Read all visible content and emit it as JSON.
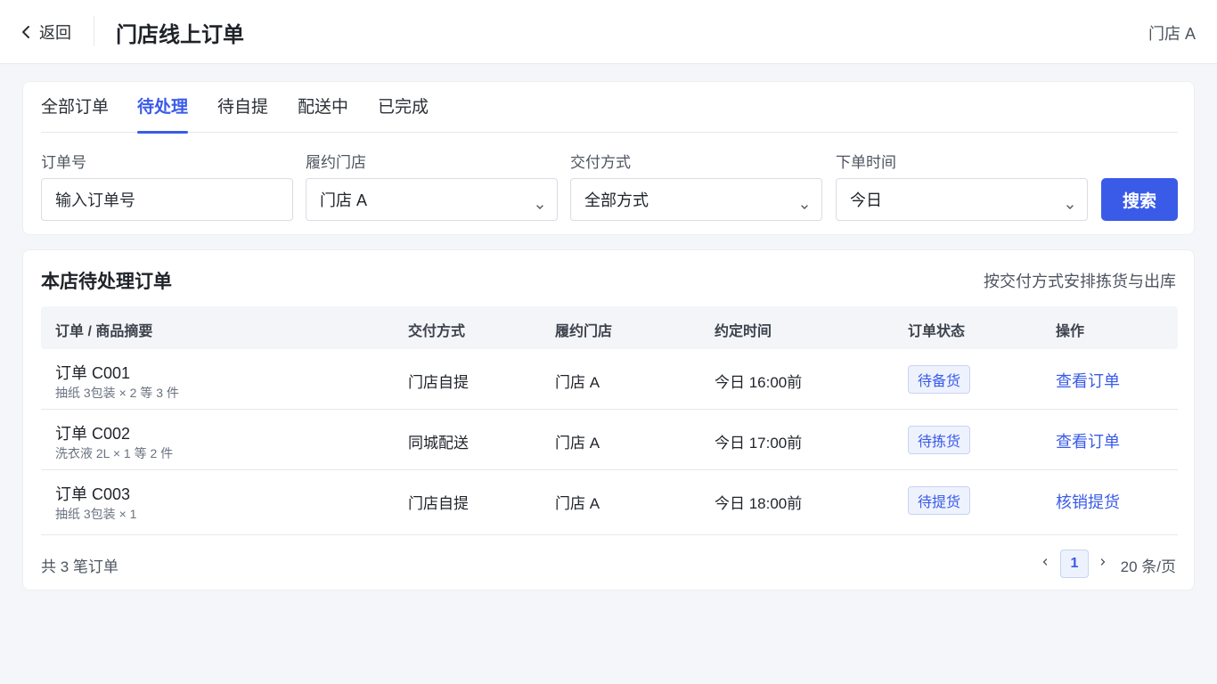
{
  "header": {
    "back_label": "返回",
    "title": "门店线上订单",
    "store": "门店 A"
  },
  "tabs": [
    {
      "label": "全部订单",
      "active": false
    },
    {
      "label": "待处理",
      "active": true
    },
    {
      "label": "待自提",
      "active": false
    },
    {
      "label": "配送中",
      "active": false
    },
    {
      "label": "已完成",
      "active": false
    }
  ],
  "filters": {
    "order_no": {
      "label": "订单号",
      "placeholder": "输入订单号"
    },
    "store": {
      "label": "履约门店",
      "value": "门店 A"
    },
    "delivery": {
      "label": "交付方式",
      "value": "全部方式"
    },
    "time": {
      "label": "下单时间",
      "value": "今日"
    },
    "search_label": "搜索"
  },
  "list": {
    "title": "本店待处理订单",
    "hint": "按交付方式安排拣货与出库",
    "columns": [
      "订单 / 商品摘要",
      "交付方式",
      "履约门店",
      "约定时间",
      "订单状态",
      "操作"
    ],
    "rows": [
      {
        "order": "订单 C001",
        "summary": "抽纸 3包装 × 2 等 3 件",
        "delivery": "门店自提",
        "store": "门店 A",
        "time": "今日 16:00前",
        "status": "待备货",
        "action": "查看订单"
      },
      {
        "order": "订单 C002",
        "summary": "洗衣液 2L × 1 等 2 件",
        "delivery": "同城配送",
        "store": "门店 A",
        "time": "今日 17:00前",
        "status": "待拣货",
        "action": "查看订单"
      },
      {
        "order": "订单 C003",
        "summary": "抽纸 3包装 × 1",
        "delivery": "门店自提",
        "store": "门店 A",
        "time": "今日 18:00前",
        "status": "待提货",
        "action": "核销提货"
      }
    ],
    "total": "共 3 笔订单",
    "page": "1",
    "page_size": "20 条/页"
  },
  "colors": {
    "accent": "#3a5be8",
    "badge_bg": "#eef2fd",
    "page_bg": "#f5f6fa"
  }
}
